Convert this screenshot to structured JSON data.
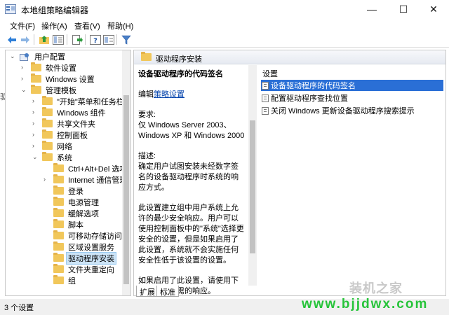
{
  "window": {
    "title": "本地组策略编辑器",
    "controls": {
      "minimize": "—",
      "maximize": "☐",
      "close": "✕"
    }
  },
  "menu": [
    "文件(F)",
    "操作(A)",
    "查看(V)",
    "帮助(H)"
  ],
  "toolbar": {
    "icons": [
      "back-arrow-icon",
      "forward-arrow-icon",
      "up-folder-icon",
      "show-hide-tree-icon",
      "export-list-icon",
      "help-icon",
      "properties-icon",
      "filter-icon"
    ]
  },
  "tree": {
    "items": [
      {
        "label": "用户配置",
        "level": 0,
        "expanded": true
      },
      {
        "label": "软件设置",
        "level": 1
      },
      {
        "label": "Windows 设置",
        "level": 1
      },
      {
        "label": "管理模板",
        "level": 1,
        "expanded": true
      },
      {
        "label": "\"开始\"菜单和任务栏",
        "level": 2
      },
      {
        "label": "Windows 组件",
        "level": 2
      },
      {
        "label": "共享文件夹",
        "level": 2
      },
      {
        "label": "控制面板",
        "level": 2
      },
      {
        "label": "网络",
        "level": 2
      },
      {
        "label": "系统",
        "level": 2,
        "expanded": true
      },
      {
        "label": "Ctrl+Alt+Del 选项",
        "level": 3
      },
      {
        "label": "Internet 通信管理",
        "level": 3
      },
      {
        "label": "登录",
        "level": 3
      },
      {
        "label": "电源管理",
        "level": 3
      },
      {
        "label": "缓解选项",
        "level": 3
      },
      {
        "label": "脚本",
        "level": 3
      },
      {
        "label": "可移动存储访问",
        "level": 3
      },
      {
        "label": "区域设置服务",
        "level": 3
      },
      {
        "label": "驱动程序安装",
        "level": 3,
        "selected": true
      },
      {
        "label": "文件夹重定向",
        "level": 3
      },
      {
        "label": "组",
        "level": 3
      }
    ]
  },
  "pane": {
    "header": "驱动程序安装",
    "description": {
      "title": "设备驱动程序的代码签名",
      "edit_prefix": "编辑",
      "edit_link": "策略设置",
      "req_label": "要求:",
      "req_text": "仅 Windows Server 2003、Windows XP 和 Windows 2000",
      "desc_label": "描述:",
      "desc_text": "确定用户试图安装未经数字签名的设备驱动程序时系统的响应方式。",
      "para2": "此设置建立组中用户系统上允许的最少安全响应。用户可以使用控制面板中的\"系统\"选择更安全的设置，但是如果启用了此设置，系统就不会实施任何安全性低于该设置的设置。",
      "para3": "如果启用了此设置，请使用下拉框指定所需的响应。"
    },
    "settings_header": "设置",
    "settings": [
      {
        "label": "设备驱动程序的代码签名",
        "selected": true
      },
      {
        "label": "配置驱动程序查找位置"
      },
      {
        "label": "关闭 Windows 更新设备驱动程序搜索提示"
      }
    ],
    "tabs": [
      "扩展",
      "标准"
    ]
  },
  "status": "3 个设置",
  "watermark": {
    "logo": "装机之家",
    "url": "www.bjjdwx.com"
  }
}
